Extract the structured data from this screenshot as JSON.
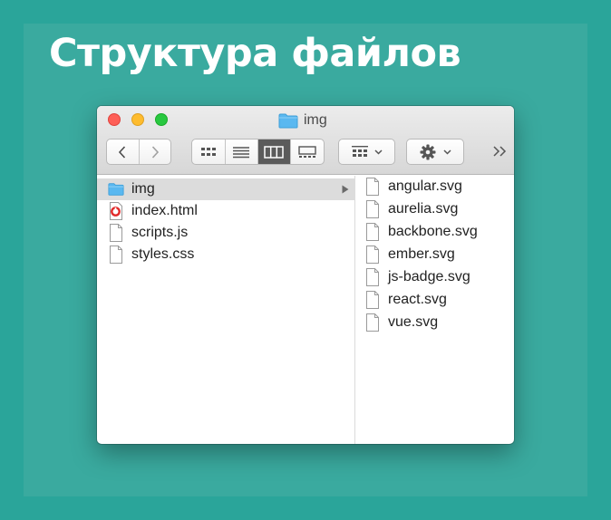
{
  "heading": "Структура файлов",
  "window": {
    "title": "img",
    "icons": {
      "back": "chevron-left-icon",
      "forward": "chevron-right-icon",
      "view_icons": "grid-icon",
      "view_list": "list-icon",
      "view_columns": "columns-icon",
      "view_gallery": "gallery-icon",
      "group": "group-icon",
      "action": "gear-icon",
      "overflow": "double-chevron-right-icon"
    },
    "active_view": "columns"
  },
  "column1": {
    "items": [
      {
        "name": "img",
        "kind": "folder",
        "selected": true
      },
      {
        "name": "index.html",
        "kind": "html"
      },
      {
        "name": "scripts.js",
        "kind": "file"
      },
      {
        "name": "styles.css",
        "kind": "file"
      }
    ]
  },
  "column2": {
    "items": [
      {
        "name": "angular.svg",
        "kind": "file"
      },
      {
        "name": "aurelia.svg",
        "kind": "file"
      },
      {
        "name": "backbone.svg",
        "kind": "file"
      },
      {
        "name": "ember.svg",
        "kind": "file"
      },
      {
        "name": "js-badge.svg",
        "kind": "file"
      },
      {
        "name": "react.svg",
        "kind": "file"
      },
      {
        "name": "vue.svg",
        "kind": "file"
      }
    ]
  },
  "colors": {
    "background": "#2aa59a",
    "folder_blue": "#5ab8f0",
    "selection": "#dcdcdc",
    "close": "#fe5f57",
    "minimize": "#febc2e",
    "zoom": "#28c840"
  }
}
